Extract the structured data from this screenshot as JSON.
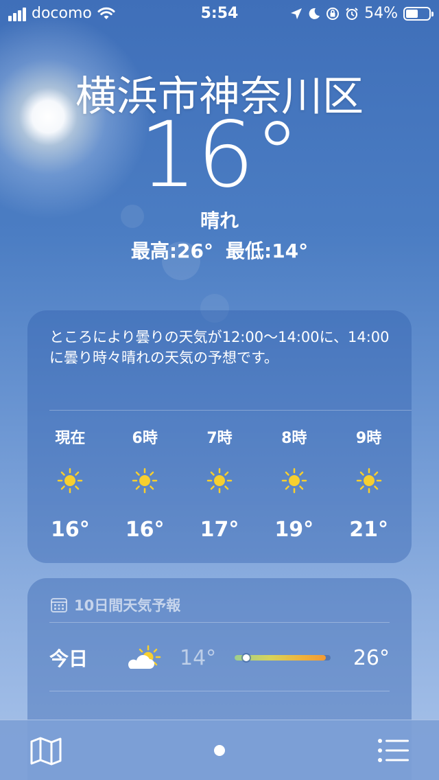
{
  "status_bar": {
    "carrier": "docomo",
    "time": "5:54",
    "battery_percent": "54%",
    "battery_level": 0.54,
    "icons": [
      "signal-bars-icon",
      "wifi-icon",
      "location-arrow-icon",
      "moon-icon",
      "rotation-lock-icon",
      "alarm-icon",
      "battery-icon"
    ]
  },
  "location": {
    "city": "横浜市神奈川区",
    "temperature": "16°",
    "condition": "晴れ",
    "high": "最高:26°",
    "low": "最低:14°"
  },
  "hourly": {
    "summary": "ところにより曇りの天気が12:00～14:00に、14:00に曇り時々晴れの天気の予想です。",
    "hours": [
      {
        "label": "現在",
        "icon": "sun-icon",
        "temp": "16°"
      },
      {
        "label": "6時",
        "icon": "sun-icon",
        "temp": "16°"
      },
      {
        "label": "7時",
        "icon": "sun-icon",
        "temp": "17°"
      },
      {
        "label": "8時",
        "icon": "sun-icon",
        "temp": "19°"
      },
      {
        "label": "9時",
        "icon": "sun-icon",
        "temp": "21°"
      }
    ]
  },
  "ten_day": {
    "title": "10日間天気予報",
    "icon": "calendar-icon",
    "days": [
      {
        "day": "今日",
        "icon": "partly-cloudy-icon",
        "low": "14°",
        "high": "26°",
        "current_position": 0.12,
        "range_start": 0.0,
        "range_end": 0.95
      }
    ]
  },
  "toolbar": {
    "map_icon": "map-icon",
    "page_indicator_icon": "page-dot-icon",
    "list_icon": "list-icon"
  },
  "colors": {
    "sun": "#f7cf2f",
    "cloud": "#ffffff"
  }
}
